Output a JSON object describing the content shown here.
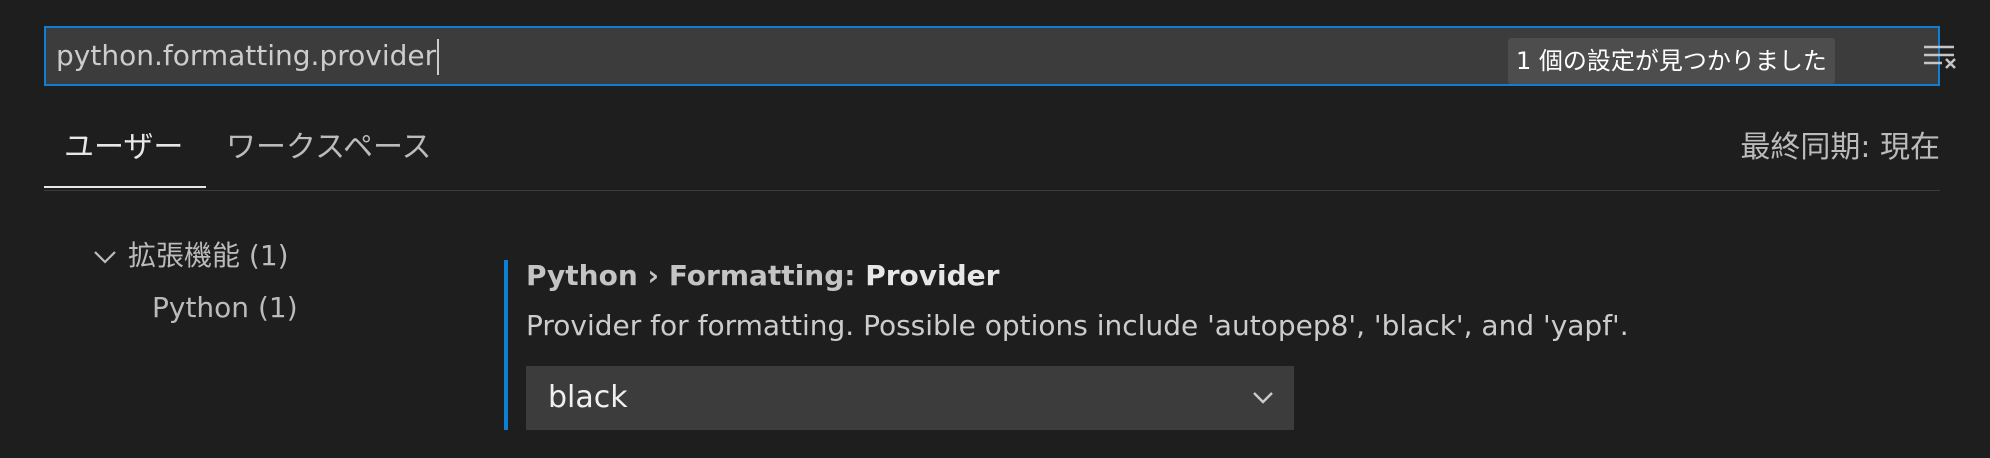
{
  "search": {
    "value": "python.formatting.provider",
    "results_count": "1 個の設定が見つかりました"
  },
  "icons": {
    "clear": "clear-filter-icon",
    "group_toggle": "chevron-down-icon",
    "select_toggle": "chevron-down-icon"
  },
  "tabs": [
    {
      "label": "ユーザー",
      "active": true
    },
    {
      "label": "ワークスペース",
      "active": false
    }
  ],
  "sync_status": "最終同期: 現在",
  "toc": {
    "group": {
      "label": "拡張機能 (1)"
    },
    "items": [
      {
        "label": "Python (1)"
      }
    ]
  },
  "setting": {
    "category": "Python › Formatting: ",
    "name": "Provider",
    "description": "Provider for formatting. Possible options include 'autopep8', 'black', and 'yapf'.",
    "value": "black"
  },
  "colors": {
    "focus_border": "#0e7fd3",
    "background": "#1e1e1e",
    "input_background": "#3c3c3c"
  }
}
